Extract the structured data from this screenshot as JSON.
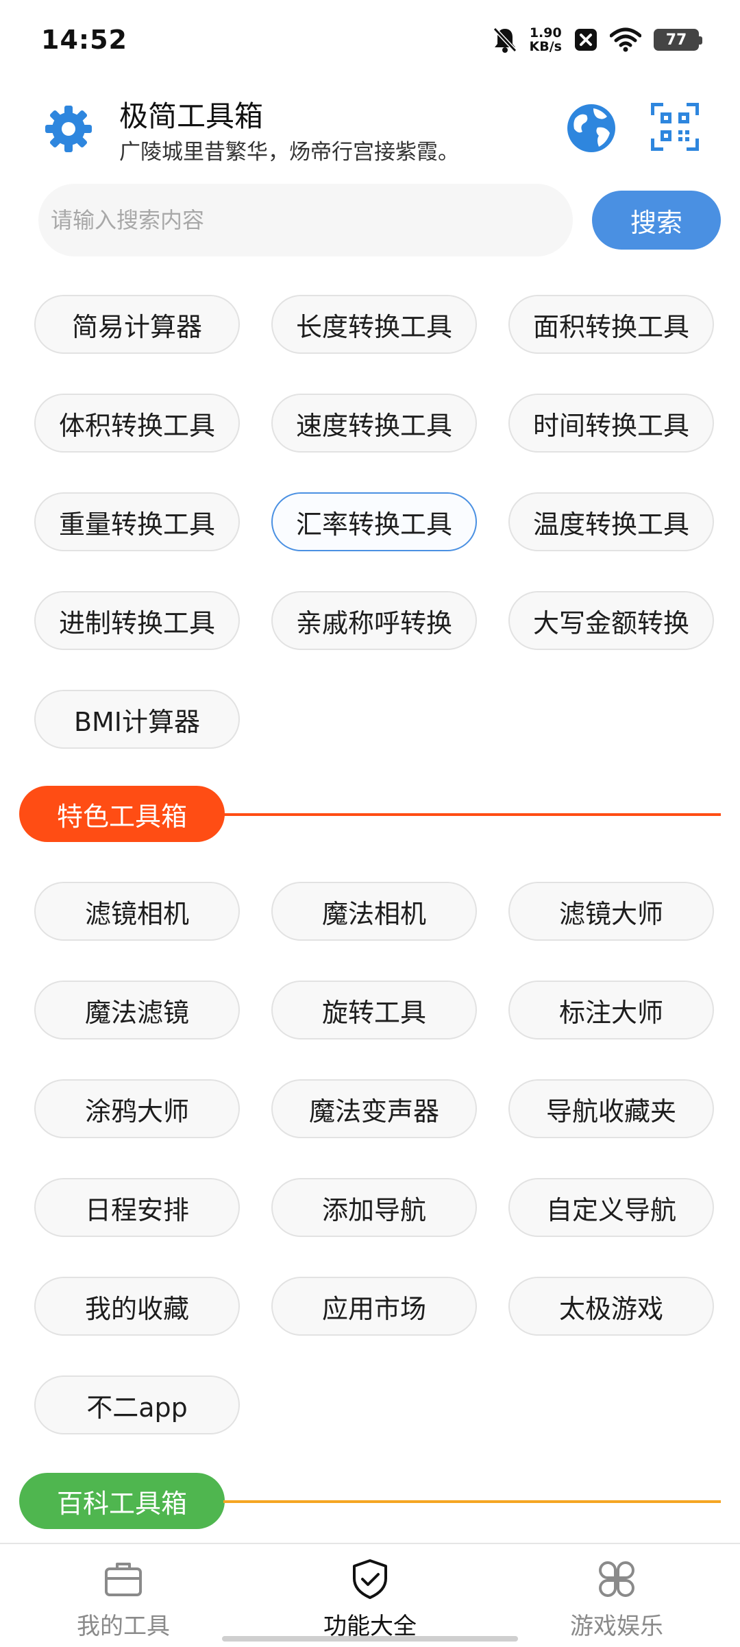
{
  "status_bar": {
    "time": "14:52",
    "net_speed_value": "1.90",
    "net_speed_unit": "KB/s",
    "battery": "77"
  },
  "header": {
    "title": "极简工具箱",
    "subtitle": "广陵城里昔繁华，炀帝行宫接紫霞。"
  },
  "search": {
    "placeholder": "请输入搜索内容",
    "button_label": "搜索"
  },
  "tools": [
    "简易计算器",
    "长度转换工具",
    "面积转换工具",
    "体积转换工具",
    "速度转换工具",
    "时间转换工具",
    "重量转换工具",
    "汇率转换工具",
    "温度转换工具",
    "进制转换工具",
    "亲戚称呼转换",
    "大写金额转换",
    "BMI计算器"
  ],
  "selected_tool": "汇率转换工具",
  "sections": {
    "feature": {
      "label": "特色工具箱",
      "color": "#ff4d14",
      "items": [
        "滤镜相机",
        "魔法相机",
        "滤镜大师",
        "魔法滤镜",
        "旋转工具",
        "标注大师",
        "涂鸦大师",
        "魔法变声器",
        "导航收藏夹",
        "日程安排",
        "添加导航",
        "自定义导航",
        "我的收藏",
        "应用市场",
        "太极游戏",
        "不二app"
      ]
    },
    "wiki": {
      "label": "百科工具箱",
      "color": "#4fb64f",
      "line_color": "#f5a623"
    }
  },
  "bottom_nav": {
    "items": [
      {
        "label": "我的工具",
        "icon": "briefcase-icon"
      },
      {
        "label": "功能大全",
        "icon": "shield-check-icon"
      },
      {
        "label": "游戏娱乐",
        "icon": "grid-flower-icon"
      }
    ],
    "active_index": 1
  },
  "colors": {
    "accent_blue": "#4a90e2",
    "feature_orange": "#ff4d14",
    "wiki_green": "#4fb64f"
  }
}
